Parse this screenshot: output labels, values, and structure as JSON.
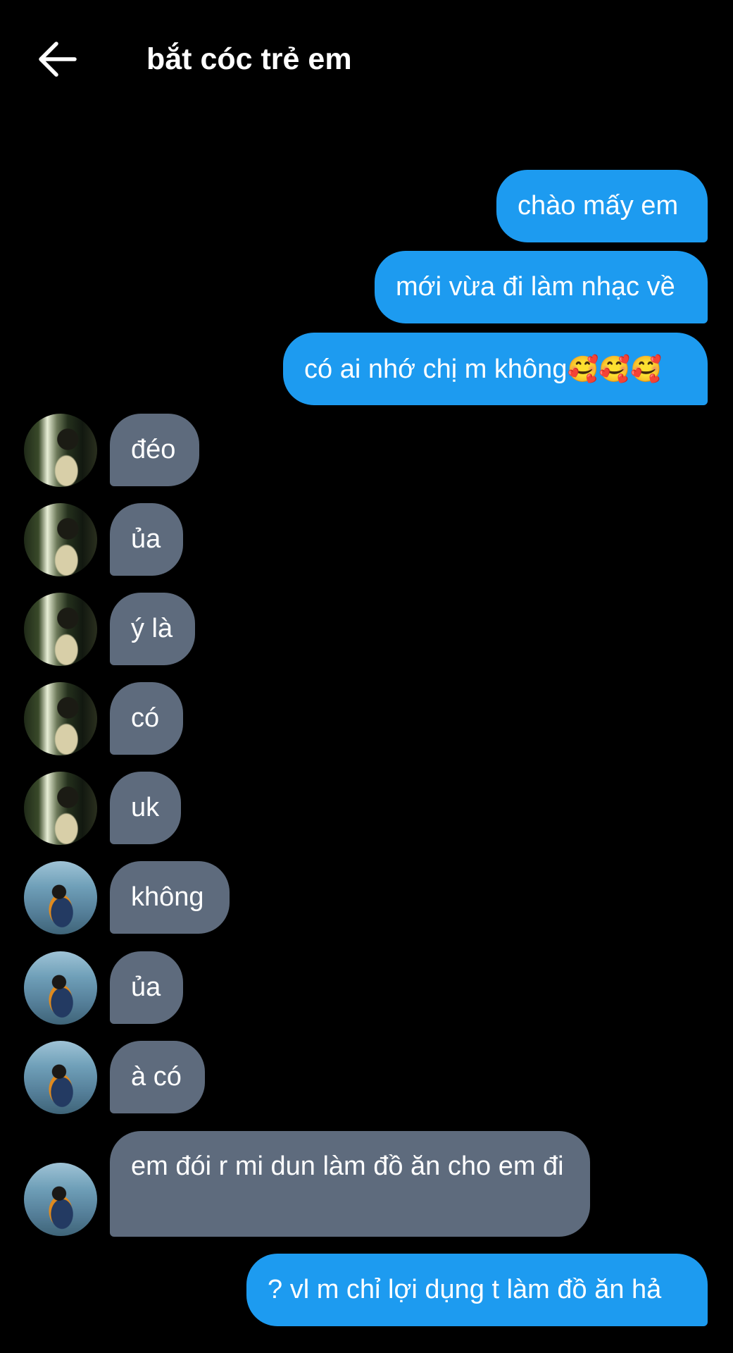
{
  "header": {
    "title": "bắt cóc trẻ em",
    "back_icon": "arrow-left-icon"
  },
  "colors": {
    "background": "#000000",
    "outgoing_bubble": "#1d9bf0",
    "incoming_bubble": "#5e6b7d",
    "text": "#ffffff"
  },
  "messages": [
    {
      "direction": "out",
      "text": "chào mấy em"
    },
    {
      "direction": "out",
      "text": "mới vừa đi làm nhạc về"
    },
    {
      "direction": "out",
      "text": "có ai nhớ chị m không",
      "emoji": "🥰🥰🥰"
    },
    {
      "direction": "in",
      "sender_avatar": "avatar-1",
      "text": "đéo"
    },
    {
      "direction": "in",
      "sender_avatar": "avatar-1",
      "text": "ủa"
    },
    {
      "direction": "in",
      "sender_avatar": "avatar-1",
      "text": "ý là"
    },
    {
      "direction": "in",
      "sender_avatar": "avatar-1",
      "text": "có"
    },
    {
      "direction": "in",
      "sender_avatar": "avatar-1",
      "text": "uk"
    },
    {
      "direction": "in",
      "sender_avatar": "avatar-2",
      "text": "không"
    },
    {
      "direction": "in",
      "sender_avatar": "avatar-2",
      "text": "ủa"
    },
    {
      "direction": "in",
      "sender_avatar": "avatar-2",
      "text": "à có"
    },
    {
      "direction": "in",
      "sender_avatar": "avatar-2",
      "text": "em đói r mi dun làm đồ ăn cho em đi"
    },
    {
      "direction": "out",
      "text": "? vl m chỉ lợi dụng t làm đồ ăn hả"
    }
  ]
}
